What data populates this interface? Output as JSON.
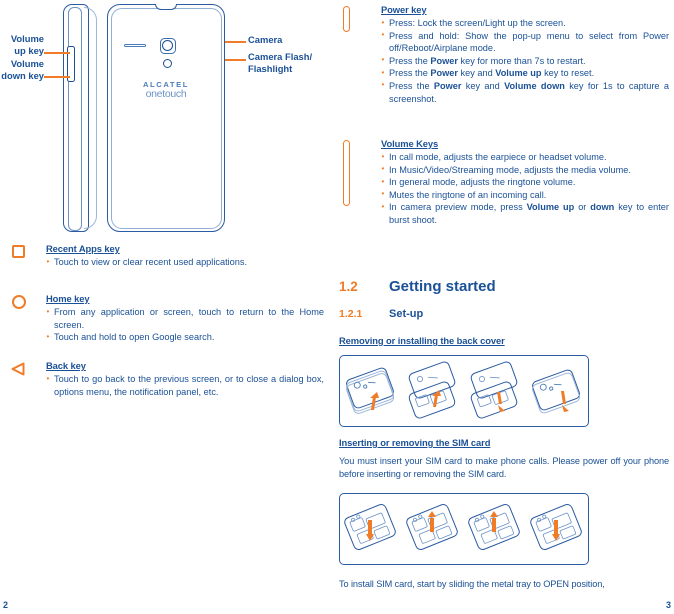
{
  "document": {
    "type": "user-manual-spread",
    "colors": {
      "accent_orange": "#F07C28",
      "text_blue": "#1B5196",
      "line_blue": "#2B5BA1"
    }
  },
  "left_page": {
    "page_number": "2",
    "figure": {
      "name": "phone-hardware-diagram",
      "brand_line1": "ALCATEL",
      "brand_line2": "onetouch",
      "callouts": [
        {
          "label": "Volume\nup key",
          "side": "left"
        },
        {
          "label": "Volume\ndown key",
          "side": "left"
        },
        {
          "label": "Camera",
          "side": "right"
        },
        {
          "label": "Camera Flash/\nFlashlight",
          "side": "right"
        }
      ],
      "label_volume_up_line1": "Volume",
      "label_volume_up_line2": "up key",
      "label_volume_down_line1": "Volume",
      "label_volume_down_line2": "down key",
      "label_camera": "Camera",
      "label_flash_line1": "Camera Flash/",
      "label_flash_line2": "Flashlight"
    },
    "key_sections": [
      {
        "icon": "square-icon",
        "title": "Recent Apps key",
        "bullets": [
          "Touch to view or clear recent used applications."
        ]
      },
      {
        "icon": "circle-icon",
        "title": "Home key",
        "bullets": [
          "From any application or screen, touch to return to the Home screen.",
          "Touch and hold to open Google search."
        ]
      },
      {
        "icon": "triangle-left-icon",
        "title": "Back key",
        "bullets": [
          "Touch to go back to the previous screen, or to close a dialog box, options menu, the notification panel, etc."
        ]
      }
    ]
  },
  "right_page": {
    "page_number": "3",
    "key_sections": [
      {
        "icon": "power-key-icon",
        "title": "Power key",
        "bullets_html": [
          "Press: Lock the screen/Light up the screen.",
          "Press and hold: Show the pop-up menu to select from Power off/Reboot/Airplane mode.",
          "Press the <b>Power</b> key for more than 7s to restart.",
          "Press the <b>Power</b> key and <b>Volume up</b> key to reset.",
          "Press the <b>Power</b> key and <b>Volume down</b> key for 1s to capture a screenshot."
        ]
      },
      {
        "icon": "volume-key-icon",
        "title": "Volume Keys ",
        "bullets_html": [
          "In call mode, adjusts the earpiece or headset volume.",
          "In Music/Video/Streaming mode, adjusts the media volume.",
          "In general mode, adjusts the ringtone volume.",
          "Mutes the ringtone of an incoming call.",
          "In camera preview mode, press <b>Volume up</b> or <b>down</b> key to enter burst shoot."
        ]
      }
    ],
    "headings": {
      "section_number": "1.2",
      "section_title": "Getting started",
      "subsection_number": "1.2.1",
      "subsection_title": "Set-up",
      "topic_back_cover": "Removing or installing the back cover",
      "topic_sim_card": "Inserting or removing the SIM card"
    },
    "paragraphs": {
      "sim_intro": "You must insert your SIM card to make phone calls. Please power off your phone before inserting or removing the SIM card.",
      "sim_outro": "To install SIM card, start by sliding the metal tray to OPEN position,"
    },
    "figures": [
      {
        "name": "back-cover-steps",
        "steps": 4
      },
      {
        "name": "sim-card-steps",
        "steps": 4
      }
    ]
  }
}
